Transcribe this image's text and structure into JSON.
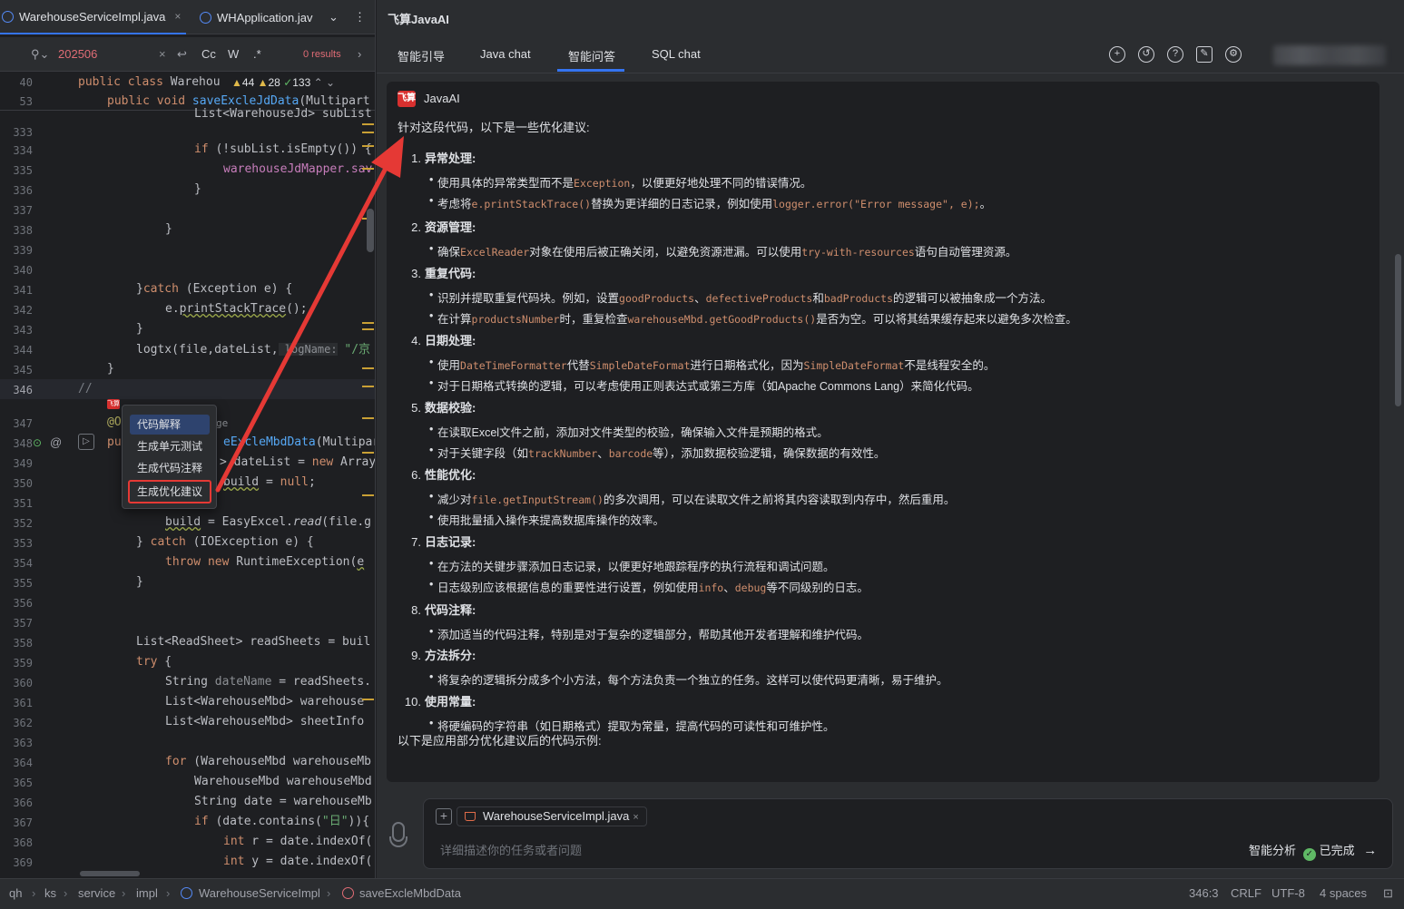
{
  "editor": {
    "tabs": [
      {
        "label": "WarehouseServiceImpl.java",
        "close": "×"
      },
      {
        "label": "WHApplication.jav",
        "chev": "⌄",
        "more": "⋮"
      }
    ],
    "find": {
      "query": "202506",
      "clear": "×",
      "cc": "Cc",
      "w": "W",
      "regex": ".*",
      "results": "0 results",
      "next": "›"
    },
    "sticky": [
      {
        "ln": "40",
        "kw": "public class ",
        "rest": "Warehou"
      },
      {
        "ln": "53",
        "kw": "public void ",
        "fn": "saveExcleJdData",
        "rest": "(Multipart"
      }
    ],
    "inspections": {
      "warnings": "44",
      "weak": "28",
      "ok": "133"
    },
    "lines": [
      {
        "ln": "333"
      },
      {
        "ln": "334"
      },
      {
        "ln": "335"
      },
      {
        "ln": "336"
      },
      {
        "ln": "337"
      },
      {
        "ln": "338"
      },
      {
        "ln": "339"
      },
      {
        "ln": "340"
      },
      {
        "ln": "341"
      },
      {
        "ln": "342"
      },
      {
        "ln": "343"
      },
      {
        "ln": "344"
      },
      {
        "ln": "345"
      },
      {
        "ln": "346"
      },
      {
        "ln": "347"
      },
      {
        "ln": "348"
      },
      {
        "ln": "349"
      },
      {
        "ln": "350"
      },
      {
        "ln": "351"
      },
      {
        "ln": "352"
      },
      {
        "ln": "353"
      },
      {
        "ln": "354"
      },
      {
        "ln": "355"
      },
      {
        "ln": "356"
      },
      {
        "ln": "357"
      },
      {
        "ln": "358"
      },
      {
        "ln": "359"
      },
      {
        "ln": "360"
      },
      {
        "ln": "361"
      },
      {
        "ln": "362"
      },
      {
        "ln": "363"
      },
      {
        "ln": "364"
      },
      {
        "ln": "365"
      },
      {
        "ln": "366"
      },
      {
        "ln": "367"
      },
      {
        "ln": "368"
      },
      {
        "ln": "369"
      }
    ],
    "code": {
      "l333": "List<WarehouseJd> subList",
      "l334a": "if",
      "l334b": " (!subList.isEmpty()) {",
      "l335": "warehouseJdMapper.sav",
      "l336": "}",
      "l338": "}",
      "l341a": "}",
      "l341b": "catch",
      "l341c": " (Exception e) {",
      "l342a": "e.",
      "l342b": "printStackTrace",
      "l342c": "();",
      "l343": "}",
      "l344a": "logtx(file,dateList,",
      "l344b": " logName:",
      "l344c": " \"/京",
      "l345": "}",
      "l346": "//",
      "l347a": "@O",
      "l347b": "ge",
      "l348a": "pu",
      "l348b": "eExcleMbdData",
      "l348c": "(Multipar",
      "l349a": "> dateList = ",
      "l349b": "new",
      "l349c": " Array",
      "l350a": "build",
      "l350b": " = ",
      "l350c": "null",
      "l350d": ";",
      "l352a": "build",
      "l352b": " = EasyExcel.",
      "l352c": "read",
      "l352d": "(file.g",
      "l353a": "} ",
      "l353b": "catch",
      "l353c": " (IOException e) {",
      "l354a": "throw new",
      "l354b": " RuntimeException(",
      "l354c": "e",
      "l355": "}",
      "l358": "List<ReadSheet> readSheets = buil",
      "l359a": "try",
      "l359b": " {",
      "l360a": "String ",
      "l360b": "dateName",
      "l360c": " = readSheets.",
      "l361": "List<WarehouseMbd> warehouse",
      "l362": "List<WarehouseMbd> sheetInfo",
      "l364a": "for",
      "l364b": " (WarehouseMbd warehouseMb",
      "l365": "WarehouseMbd warehouseMbd",
      "l366": "String date = warehouseMb",
      "l367a": "if",
      "l367b": " (date.contains(",
      "l367c": "\"日\"",
      "l367d": ")){",
      "l368a": "int",
      "l368b": " r = date.indexOf(",
      "l369a": "int",
      "l369b": " y = date.indexOf("
    },
    "context_menu": [
      "代码解释",
      "生成单元测试",
      "生成代码注释",
      "生成优化建议"
    ],
    "gutter_logo": "飞算"
  },
  "panel": {
    "title": "飞算JavaAI",
    "tabs": [
      "智能引导",
      "Java chat",
      "智能问答",
      "SQL chat"
    ],
    "active_tab": "智能问答",
    "icons": [
      "add-icon",
      "history-icon",
      "help-icon",
      "edit-icon",
      "settings-icon"
    ],
    "assistant_logo": "飞算",
    "assistant_name": "JavaAI",
    "intro": "针对这段代码，以下是一些优化建议:",
    "sections": [
      {
        "num": "1.",
        "title": "异常处理",
        "items": [
          [
            {
              "t": "使用具体的异常类型而不是"
            },
            {
              "c": "Exception"
            },
            {
              "t": "，以便更好地处理不同的错误情况。"
            }
          ],
          [
            {
              "t": "考虑将"
            },
            {
              "c": "e.printStackTrace()"
            },
            {
              "t": "替换为更详细的日志记录，例如使用"
            },
            {
              "c": "logger.error(\"Error message\", e);"
            },
            {
              "t": "。"
            }
          ]
        ]
      },
      {
        "num": "2.",
        "title": "资源管理",
        "items": [
          [
            {
              "t": "确保"
            },
            {
              "c": "ExcelReader"
            },
            {
              "t": "对象在使用后被正确关闭，以避免资源泄漏。可以使用"
            },
            {
              "c": "try-with-resources"
            },
            {
              "t": "语句自动管理资源。"
            }
          ]
        ]
      },
      {
        "num": "3.",
        "title": "重复代码",
        "items": [
          [
            {
              "t": "识别并提取重复代码块。例如，设置"
            },
            {
              "c": "goodProducts"
            },
            {
              "t": "、"
            },
            {
              "c": "defectiveProducts"
            },
            {
              "t": "和"
            },
            {
              "c": "badProducts"
            },
            {
              "t": "的逻辑可以被抽象成一个方法。"
            }
          ],
          [
            {
              "t": "在计算"
            },
            {
              "c": "productsNumber"
            },
            {
              "t": "时，重复检查"
            },
            {
              "c": "warehouseMbd.getGoodProducts()"
            },
            {
              "t": "是否为空。可以将其结果缓存起来以避免多次检查。"
            }
          ]
        ]
      },
      {
        "num": "4.",
        "title": "日期处理",
        "items": [
          [
            {
              "t": "使用"
            },
            {
              "c": "DateTimeFormatter"
            },
            {
              "t": "代替"
            },
            {
              "c": "SimpleDateFormat"
            },
            {
              "t": "进行日期格式化，因为"
            },
            {
              "c": "SimpleDateFormat"
            },
            {
              "t": "不是线程安全的。"
            }
          ],
          [
            {
              "t": "对于日期格式转换的逻辑，可以考虑使用正则表达式或第三方库（如Apache Commons Lang）来简化代码。"
            }
          ]
        ]
      },
      {
        "num": "5.",
        "title": "数据校验",
        "items": [
          [
            {
              "t": "在读取Excel文件之前，添加对文件类型的校验，确保输入文件是预期的格式。"
            }
          ],
          [
            {
              "t": "对于关键字段（如"
            },
            {
              "c": "trackNumber"
            },
            {
              "t": "、"
            },
            {
              "c": "barcode"
            },
            {
              "t": "等），添加数据校验逻辑，确保数据的有效性。"
            }
          ]
        ]
      },
      {
        "num": "6.",
        "title": "性能优化",
        "items": [
          [
            {
              "t": "减少对"
            },
            {
              "c": "file.getInputStream()"
            },
            {
              "t": "的多次调用，可以在读取文件之前将其内容读取到内存中，然后重用。"
            }
          ],
          [
            {
              "t": "使用批量插入操作来提高数据库操作的效率。"
            }
          ]
        ]
      },
      {
        "num": "7.",
        "title": "日志记录",
        "items": [
          [
            {
              "t": "在方法的关键步骤添加日志记录，以便更好地跟踪程序的执行流程和调试问题。"
            }
          ],
          [
            {
              "t": "日志级别应该根据信息的重要性进行设置，例如使用"
            },
            {
              "c": "info"
            },
            {
              "t": "、"
            },
            {
              "c": "debug"
            },
            {
              "t": "等不同级别的日志。"
            }
          ]
        ]
      },
      {
        "num": "8.",
        "title": "代码注释",
        "items": [
          [
            {
              "t": "添加适当的代码注释，特别是对于复杂的逻辑部分，帮助其他开发者理解和维护代码。"
            }
          ]
        ]
      },
      {
        "num": "9.",
        "title": "方法拆分",
        "items": [
          [
            {
              "t": "将复杂的逻辑拆分成多个小方法，每个方法负责一个独立的任务。这样可以使代码更清晰，易于维护。"
            }
          ]
        ]
      },
      {
        "num": "10.",
        "title": "使用常量",
        "items": [
          [
            {
              "t": "将硬编码的字符串（如日期格式）提取为常量，提高代码的可读性和可维护性。"
            }
          ]
        ]
      }
    ],
    "outro": "以下是应用部分优化建议后的代码示例:",
    "input": {
      "attachment": "WarehouseServiceImpl.java",
      "placeholder": "详细描述你的任务或者问题",
      "mode": "智能分析",
      "status": "已完成",
      "send": "→"
    }
  },
  "statusbar": {
    "breadcrumb": [
      "qh",
      "ks",
      "service",
      "impl",
      "WarehouseServiceImpl",
      "saveExcleMbdData"
    ],
    "position": "346:3",
    "line_ending": "CRLF",
    "encoding": "UTF-8",
    "indent": "4 spaces"
  },
  "colors": {
    "accent": "#3574f0",
    "arrow": "#e53935",
    "code_token": "#cf8e6d"
  }
}
